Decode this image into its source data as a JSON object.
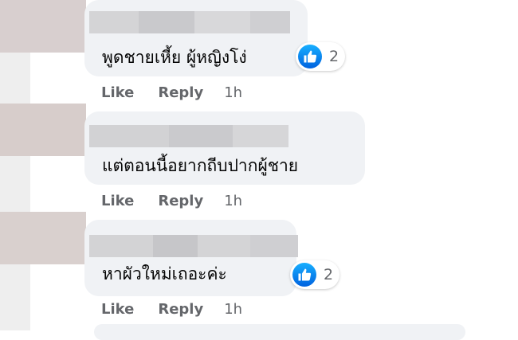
{
  "comments": [
    {
      "text": "พูดชายเหี้ย ผู้หญิงโง่",
      "reaction_count": "2",
      "actions": {
        "like": "Like",
        "reply": "Reply",
        "time": "1h"
      }
    },
    {
      "text": "แต่ตอนนี้อยากถีบปากผู้ชาย",
      "actions": {
        "like": "Like",
        "reply": "Reply",
        "time": "1h"
      }
    },
    {
      "text": "หาผัวใหม่เถอะค่ะ",
      "reaction_count": "2",
      "actions": {
        "like": "Like",
        "reply": "Reply",
        "time": "1h"
      }
    }
  ],
  "icons": {
    "reaction": "like-icon"
  },
  "colors": {
    "like_blue": "#0866ff",
    "bubble": "#f0f2f5",
    "meta_text": "#65676b"
  }
}
